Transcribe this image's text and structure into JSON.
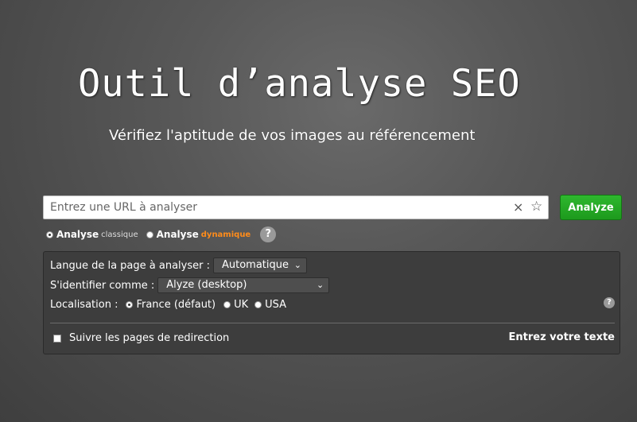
{
  "header": {
    "title": "Outil d’analyse SEO",
    "subtitle": "Vérifiez l'aptitude de vos images au référencement"
  },
  "search": {
    "placeholder": "Entrez une URL à analyser",
    "value": "",
    "clear_icon": "×",
    "favorite_icon": "☆",
    "analyze_label": "Analyze"
  },
  "modes": {
    "classic_label": "Analyse",
    "classic_suffix": "classique",
    "dynamic_label": "Analyse",
    "dynamic_suffix": "dynamique",
    "help": "?",
    "selected": "classique",
    "accent_color": "#ff8c1a"
  },
  "options": {
    "language_label": "Langue de la page à analyser :",
    "language_value": "Automatique",
    "identify_label": "S'identifier comme :",
    "identify_value": "Alyze (desktop)",
    "location_label": "Localisation :",
    "locations": [
      "France (défaut)",
      "UK",
      "USA"
    ],
    "selected_location": "France (défaut)",
    "help": "?",
    "follow_redirects_label": "Suivre les pages de redirection",
    "follow_redirects_checked": false,
    "enter_text_link": "Entrez votre texte"
  },
  "colors": {
    "analyze_button": "#1d9a1d"
  }
}
